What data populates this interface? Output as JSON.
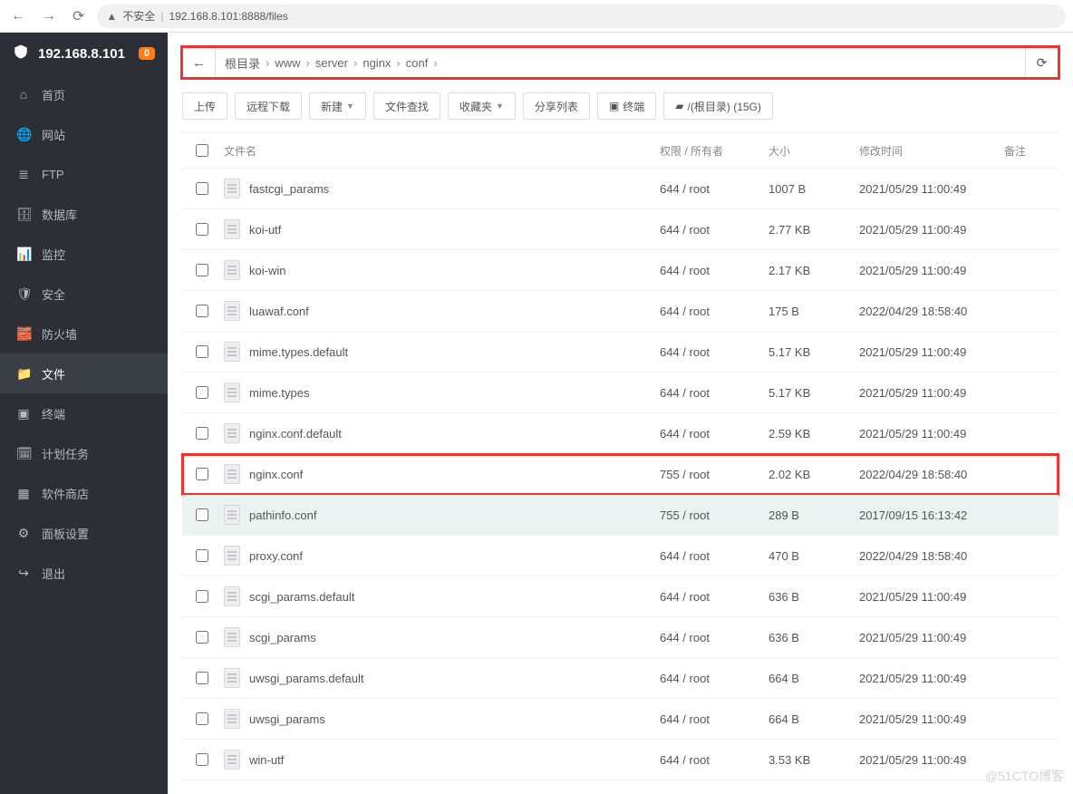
{
  "browser": {
    "insecure_label": "不安全",
    "url": "192.168.8.101:8888/files"
  },
  "sidebar": {
    "host_ip": "192.168.8.101",
    "badge_count": "0",
    "items": [
      {
        "label": "首页",
        "icon": "home"
      },
      {
        "label": "网站",
        "icon": "globe"
      },
      {
        "label": "FTP",
        "icon": "stack"
      },
      {
        "label": "数据库",
        "icon": "db"
      },
      {
        "label": "监控",
        "icon": "monitor"
      },
      {
        "label": "安全",
        "icon": "shield"
      },
      {
        "label": "防火墙",
        "icon": "wall"
      },
      {
        "label": "文件",
        "icon": "folder",
        "active": true
      },
      {
        "label": "终端",
        "icon": "terminal"
      },
      {
        "label": "计划任务",
        "icon": "tasks"
      },
      {
        "label": "软件商店",
        "icon": "apps"
      },
      {
        "label": "面板设置",
        "icon": "settings"
      },
      {
        "label": "退出",
        "icon": "logout"
      }
    ]
  },
  "breadcrumb": [
    "根目录",
    "www",
    "server",
    "nginx",
    "conf"
  ],
  "toolbar": {
    "upload": "上传",
    "remote_dl": "远程下载",
    "new": "新建",
    "search": "文件查找",
    "favorites": "收藏夹",
    "share": "分享列表",
    "terminal": "终端",
    "disk": "/(根目录) (15G)"
  },
  "columns": {
    "name": "文件名",
    "perm": "权限 / 所有者",
    "size": "大小",
    "date": "修改时间",
    "note": "备注"
  },
  "files": [
    {
      "name": "fastcgi_params",
      "perm": "644 / root",
      "size": "1007 B",
      "date": "2021/05/29 11:00:49"
    },
    {
      "name": "koi-utf",
      "perm": "644 / root",
      "size": "2.77 KB",
      "date": "2021/05/29 11:00:49"
    },
    {
      "name": "koi-win",
      "perm": "644 / root",
      "size": "2.17 KB",
      "date": "2021/05/29 11:00:49"
    },
    {
      "name": "luawaf.conf",
      "perm": "644 / root",
      "size": "175 B",
      "date": "2022/04/29 18:58:40"
    },
    {
      "name": "mime.types.default",
      "perm": "644 / root",
      "size": "5.17 KB",
      "date": "2021/05/29 11:00:49"
    },
    {
      "name": "mime.types",
      "perm": "644 / root",
      "size": "5.17 KB",
      "date": "2021/05/29 11:00:49"
    },
    {
      "name": "nginx.conf.default",
      "perm": "644 / root",
      "size": "2.59 KB",
      "date": "2021/05/29 11:00:49"
    },
    {
      "name": "nginx.conf",
      "perm": "755 / root",
      "size": "2.02 KB",
      "date": "2022/04/29 18:58:40",
      "highlighted": true
    },
    {
      "name": "pathinfo.conf",
      "perm": "755 / root",
      "size": "289 B",
      "date": "2017/09/15 16:13:42",
      "hovered": true
    },
    {
      "name": "proxy.conf",
      "perm": "644 / root",
      "size": "470 B",
      "date": "2022/04/29 18:58:40"
    },
    {
      "name": "scgi_params.default",
      "perm": "644 / root",
      "size": "636 B",
      "date": "2021/05/29 11:00:49"
    },
    {
      "name": "scgi_params",
      "perm": "644 / root",
      "size": "636 B",
      "date": "2021/05/29 11:00:49"
    },
    {
      "name": "uwsgi_params.default",
      "perm": "644 / root",
      "size": "664 B",
      "date": "2021/05/29 11:00:49"
    },
    {
      "name": "uwsgi_params",
      "perm": "644 / root",
      "size": "664 B",
      "date": "2021/05/29 11:00:49"
    },
    {
      "name": "win-utf",
      "perm": "644 / root",
      "size": "3.53 KB",
      "date": "2021/05/29 11:00:49"
    }
  ],
  "watermark": "@51CTO博客"
}
